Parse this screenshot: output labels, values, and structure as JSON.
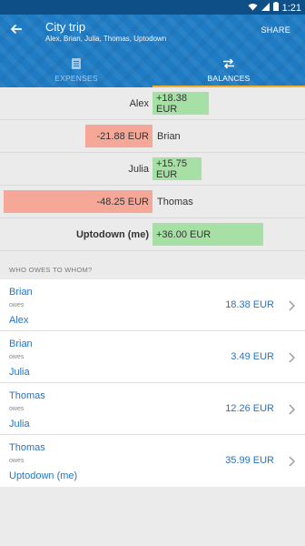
{
  "status_bar": {
    "time": "1:21"
  },
  "app_bar": {
    "title": "City trip",
    "subtitle": "Alex, Brian, Julia, Thomas, Uptodown",
    "share_label": "SHARE"
  },
  "tabs": [
    {
      "label": "EXPENSES",
      "icon": "list-icon",
      "active": false
    },
    {
      "label": "BALANCES",
      "icon": "swap-arrows-icon",
      "active": true
    }
  ],
  "balances": [
    {
      "name": "Alex",
      "value": "+18.38 EUR",
      "sign": "positive",
      "amount": 18.38
    },
    {
      "name": "Brian",
      "value": "-21.88 EUR",
      "sign": "negative",
      "amount": -21.88
    },
    {
      "name": "Julia",
      "value": "+15.75 EUR",
      "sign": "positive",
      "amount": 15.75
    },
    {
      "name": "Thomas",
      "value": "-48.25 EUR",
      "sign": "negative",
      "amount": -48.25
    },
    {
      "name": "Uptodown (me)",
      "value": "+36.00 EUR",
      "sign": "positive",
      "amount": 36.0
    }
  ],
  "section_header": "WHO OWES TO WHOM?",
  "debts": [
    {
      "debtor": "Brian",
      "owes": "owes",
      "creditor": "Alex",
      "amount": "18.38 EUR"
    },
    {
      "debtor": "Brian",
      "owes": "owes",
      "creditor": "Julia",
      "amount": "3.49 EUR"
    },
    {
      "debtor": "Thomas",
      "owes": "owes",
      "creditor": "Julia",
      "amount": "12.26 EUR"
    },
    {
      "debtor": "Thomas",
      "owes": "owes",
      "creditor": "Uptodown (me)",
      "amount": "35.99 EUR"
    }
  ],
  "colors": {
    "app_bar": "#1f7bc4",
    "status_bar": "#0d4f86",
    "tab_indicator": "#f2b02b",
    "positive_bar": "#a6e0a4",
    "negative_bar": "#f5a898",
    "link_text": "#2a74bb"
  }
}
